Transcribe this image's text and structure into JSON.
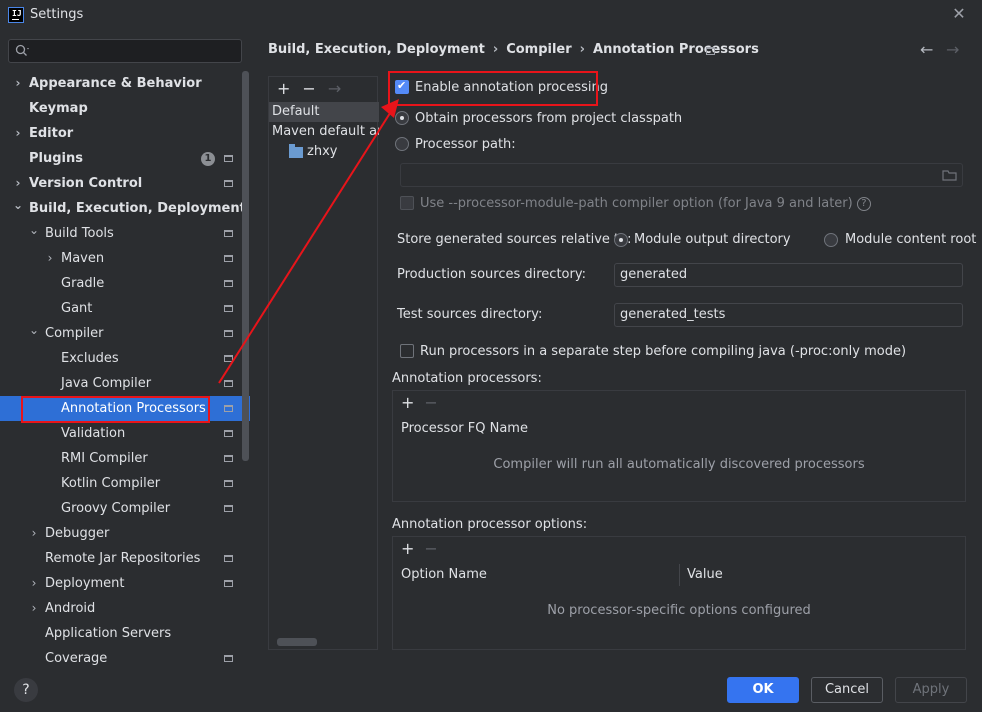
{
  "window": {
    "title": "Settings",
    "app_icon_label": "IJ",
    "close_glyph": "✕"
  },
  "sidebar": {
    "items": [
      {
        "label": "Appearance & Behavior",
        "bold": true,
        "expander": "collapsed"
      },
      {
        "label": "Keymap",
        "bold": true
      },
      {
        "label": "Editor",
        "bold": true,
        "expander": "collapsed"
      },
      {
        "label": "Plugins",
        "bold": true,
        "badge": "1",
        "project_icon": true
      },
      {
        "label": "Version Control",
        "bold": true,
        "expander": "collapsed",
        "project_icon": true
      },
      {
        "label": "Build, Execution, Deployment",
        "bold": true,
        "expander": "expanded"
      },
      {
        "label": "Build Tools",
        "expander": "expanded",
        "project_icon": true
      },
      {
        "label": "Maven",
        "expander": "collapsed",
        "project_icon": true
      },
      {
        "label": "Gradle",
        "project_icon": true
      },
      {
        "label": "Gant",
        "project_icon": true
      },
      {
        "label": "Compiler",
        "expander": "expanded",
        "project_icon": true
      },
      {
        "label": "Excludes",
        "project_icon": true
      },
      {
        "label": "Java Compiler",
        "project_icon": true
      },
      {
        "label": "Annotation Processors",
        "selected": true,
        "project_icon": true
      },
      {
        "label": "Validation",
        "project_icon": true
      },
      {
        "label": "RMI Compiler",
        "project_icon": true
      },
      {
        "label": "Kotlin Compiler",
        "project_icon": true
      },
      {
        "label": "Groovy Compiler",
        "project_icon": true
      },
      {
        "label": "Debugger",
        "expander": "collapsed"
      },
      {
        "label": "Remote Jar Repositories",
        "project_icon": true
      },
      {
        "label": "Deployment",
        "expander": "collapsed",
        "project_icon": true
      },
      {
        "label": "Android",
        "expander": "collapsed"
      },
      {
        "label": "Application Servers"
      },
      {
        "label": "Coverage",
        "project_icon": true
      }
    ]
  },
  "breadcrumb": {
    "items": [
      "Build, Execution, Deployment",
      "Compiler",
      "Annotation Processors"
    ],
    "separator": "›",
    "back_glyph": "←",
    "forward_glyph": "→"
  },
  "profiles": {
    "toolbar": {
      "add": "+",
      "remove": "−",
      "move": "→"
    },
    "items": [
      "Default",
      "Maven default annotation processors profile",
      "zhxy"
    ]
  },
  "settings": {
    "enable_label": "Enable annotation processing",
    "enable_checked": true,
    "obtain_label": "Obtain processors from project classpath",
    "processor_path_label": "Processor path:",
    "processor_path_value": "",
    "module_path_label": "Use --processor-module-path compiler option (for Java 9 and later)",
    "help_glyph": "?",
    "store_label": "Store generated sources relative to:",
    "module_output_label": "Module output directory",
    "module_content_label": "Module content root",
    "production_label": "Production sources directory:",
    "production_value": "generated",
    "test_label": "Test sources directory:",
    "test_value": "generated_tests",
    "run_separate_label": "Run processors in a separate step before compiling java (-proc:only mode)"
  },
  "processors_panel": {
    "title": "Annotation processors:",
    "add": "+",
    "remove": "−",
    "column": "Processor FQ Name",
    "empty_text": "Compiler will run all automatically discovered processors"
  },
  "options_panel": {
    "title": "Annotation processor options:",
    "add": "+",
    "remove": "−",
    "columns": [
      "Option Name",
      "Value"
    ],
    "empty_text": "No processor-specific options configured"
  },
  "footer": {
    "help": "?",
    "ok": "OK",
    "cancel": "Cancel",
    "apply": "Apply"
  },
  "colors": {
    "accent": "#3574f0",
    "selection": "#2e6fd6",
    "annotation_red": "#e8141a",
    "background": "#2b2d30"
  }
}
